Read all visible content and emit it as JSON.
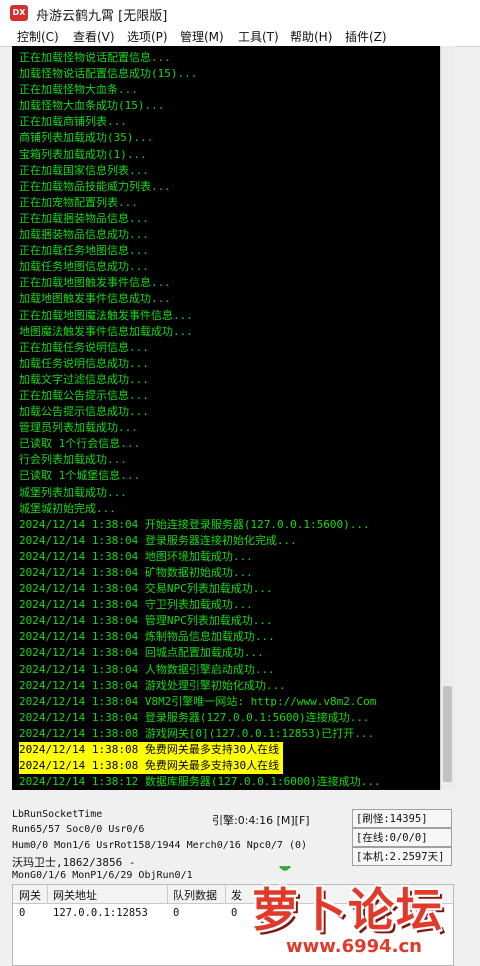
{
  "window": {
    "title": "舟游云鹤九霄 [无限版]",
    "icon_text": "DX"
  },
  "menu": [
    {
      "label": "控制(C)"
    },
    {
      "label": "查看(V)"
    },
    {
      "label": "选项(P)"
    },
    {
      "label": "管理(M)"
    },
    {
      "label": "工具(T)"
    },
    {
      "label": "帮助(H)"
    },
    {
      "label": "插件(Z)"
    }
  ],
  "log": [
    {
      "text": "正在加载怪物说话配置信息..."
    },
    {
      "text": "加载怪物说话配置信息成功(15)..."
    },
    {
      "text": "正在加载怪物大血条..."
    },
    {
      "text": "加载怪物大血条成功(15)..."
    },
    {
      "text": "正在加载商铺列表..."
    },
    {
      "text": "商铺列表加载成功(35)..."
    },
    {
      "text": "宝箱列表加载成功(1)..."
    },
    {
      "text": "正在加载国家信息列表..."
    },
    {
      "text": "正在加载物品技能威力列表..."
    },
    {
      "text": "正在加宠物配置列表..."
    },
    {
      "text": "正在加载捆装物品信息..."
    },
    {
      "text": "加载捆装物品信息成功..."
    },
    {
      "text": "正在加载任务地图信息..."
    },
    {
      "text": "加载任务地图信息成功..."
    },
    {
      "text": "正在加载地图触发事件信息..."
    },
    {
      "text": "加载地图触发事件信息成功..."
    },
    {
      "text": "正在加载地图魔法触发事件信息..."
    },
    {
      "text": "地图魔法触发事件信息加载成功..."
    },
    {
      "text": "正在加载任务说明信息..."
    },
    {
      "text": "加载任务说明信息成功..."
    },
    {
      "text": "加载文字过滤信息成功..."
    },
    {
      "text": "正在加载公告提示信息..."
    },
    {
      "text": "加载公告提示信息成功..."
    },
    {
      "text": "管理员列表加载成功..."
    },
    {
      "text": "已读取 1个行会信息..."
    },
    {
      "text": "行会列表加载成功..."
    },
    {
      "text": "已读取 1个城堡信息..."
    },
    {
      "text": "城堡列表加载成功..."
    },
    {
      "text": "城堡城初始完成..."
    },
    {
      "text": "2024/12/14 1:38:04 开始连接登录服务器(127.0.0.1:5600)..."
    },
    {
      "text": "2024/12/14 1:38:04 登录服务器连接初始化完成..."
    },
    {
      "text": "2024/12/14 1:38:04 地图环境加载成功..."
    },
    {
      "text": "2024/12/14 1:38:04 矿物数据初始成功..."
    },
    {
      "text": "2024/12/14 1:38:04 交易NPC列表加载成功..."
    },
    {
      "text": "2024/12/14 1:38:04 守卫列表加载成功..."
    },
    {
      "text": "2024/12/14 1:38:04 管理NPC列表加载成功..."
    },
    {
      "text": "2024/12/14 1:38:04 炼制物品信息加载成功..."
    },
    {
      "text": "2024/12/14 1:38:04 回城点配置加载成功..."
    },
    {
      "text": "2024/12/14 1:38:04 人物数据引擎启动成功..."
    },
    {
      "text": "2024/12/14 1:38:04 游戏处理引擎初始化成功..."
    },
    {
      "text": "2024/12/14 1:38:04 V8M2引擎唯一网站: http://www.v8m2.Com"
    },
    {
      "text": "2024/12/14 1:38:04 登录服务器(127.0.0.1:5600)连接成功..."
    },
    {
      "text": "2024/12/14 1:38:08 游戏网关[0](127.0.0.1:12853)已打开..."
    },
    {
      "text": "2024/12/14 1:38:08 免费网关最多支持30人在线",
      "highlight": true
    },
    {
      "text": "2024/12/14 1:38:08 免费网关最多支持30人在线",
      "highlight": true
    },
    {
      "text": "2024/12/14 1:38:12 数据库服务器(127.0.0.1:6000)连接成功..."
    }
  ],
  "status": {
    "line1": "LbRunSocketTime",
    "line2": "Run65/57 Soc0/0 Usr0/6",
    "line3": "Hum0/0 Mon1/6 UsrRot158/1944 Merch0/16 Npc0/7 (0)",
    "line4": "沃玛卫士,1862/3856 -",
    "line5": "MonG0/1/6 MonP1/6/29 ObjRun0/1",
    "engine": "引擎:0:4:16 [M][F]",
    "refresh": "[刷怪:14395]",
    "online": "[在线:0/0/0]",
    "local": "[本机:2.2597天]"
  },
  "grid": {
    "headers": [
      "网关",
      "网关地址",
      "队列数据",
      "发"
    ],
    "row": [
      "0",
      "127.0.0.1:12853",
      "0",
      "0"
    ]
  },
  "watermark": {
    "title": "萝卜论坛",
    "url": "www.6994.cn"
  },
  "colors": {
    "console_bg": "#000000",
    "console_text": "#16d916",
    "highlight": "#ffff00",
    "watermark": "#e23a2a"
  }
}
